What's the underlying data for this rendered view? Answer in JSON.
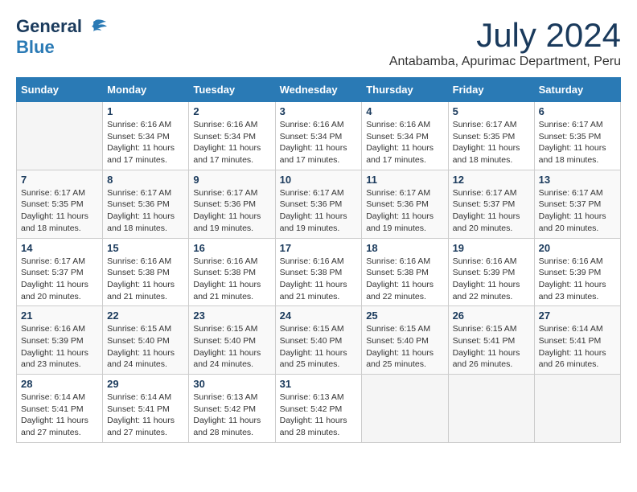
{
  "logo": {
    "general": "General",
    "blue": "Blue"
  },
  "title": "July 2024",
  "location": "Antabamba, Apurimac Department, Peru",
  "headers": [
    "Sunday",
    "Monday",
    "Tuesday",
    "Wednesday",
    "Thursday",
    "Friday",
    "Saturday"
  ],
  "weeks": [
    [
      {
        "day": "",
        "sunrise": "",
        "sunset": "",
        "daylight": ""
      },
      {
        "day": "1",
        "sunrise": "Sunrise: 6:16 AM",
        "sunset": "Sunset: 5:34 PM",
        "daylight": "Daylight: 11 hours and 17 minutes."
      },
      {
        "day": "2",
        "sunrise": "Sunrise: 6:16 AM",
        "sunset": "Sunset: 5:34 PM",
        "daylight": "Daylight: 11 hours and 17 minutes."
      },
      {
        "day": "3",
        "sunrise": "Sunrise: 6:16 AM",
        "sunset": "Sunset: 5:34 PM",
        "daylight": "Daylight: 11 hours and 17 minutes."
      },
      {
        "day": "4",
        "sunrise": "Sunrise: 6:16 AM",
        "sunset": "Sunset: 5:34 PM",
        "daylight": "Daylight: 11 hours and 17 minutes."
      },
      {
        "day": "5",
        "sunrise": "Sunrise: 6:17 AM",
        "sunset": "Sunset: 5:35 PM",
        "daylight": "Daylight: 11 hours and 18 minutes."
      },
      {
        "day": "6",
        "sunrise": "Sunrise: 6:17 AM",
        "sunset": "Sunset: 5:35 PM",
        "daylight": "Daylight: 11 hours and 18 minutes."
      }
    ],
    [
      {
        "day": "7",
        "sunrise": "Sunrise: 6:17 AM",
        "sunset": "Sunset: 5:35 PM",
        "daylight": "Daylight: 11 hours and 18 minutes."
      },
      {
        "day": "8",
        "sunrise": "Sunrise: 6:17 AM",
        "sunset": "Sunset: 5:36 PM",
        "daylight": "Daylight: 11 hours and 18 minutes."
      },
      {
        "day": "9",
        "sunrise": "Sunrise: 6:17 AM",
        "sunset": "Sunset: 5:36 PM",
        "daylight": "Daylight: 11 hours and 19 minutes."
      },
      {
        "day": "10",
        "sunrise": "Sunrise: 6:17 AM",
        "sunset": "Sunset: 5:36 PM",
        "daylight": "Daylight: 11 hours and 19 minutes."
      },
      {
        "day": "11",
        "sunrise": "Sunrise: 6:17 AM",
        "sunset": "Sunset: 5:36 PM",
        "daylight": "Daylight: 11 hours and 19 minutes."
      },
      {
        "day": "12",
        "sunrise": "Sunrise: 6:17 AM",
        "sunset": "Sunset: 5:37 PM",
        "daylight": "Daylight: 11 hours and 20 minutes."
      },
      {
        "day": "13",
        "sunrise": "Sunrise: 6:17 AM",
        "sunset": "Sunset: 5:37 PM",
        "daylight": "Daylight: 11 hours and 20 minutes."
      }
    ],
    [
      {
        "day": "14",
        "sunrise": "Sunrise: 6:17 AM",
        "sunset": "Sunset: 5:37 PM",
        "daylight": "Daylight: 11 hours and 20 minutes."
      },
      {
        "day": "15",
        "sunrise": "Sunrise: 6:16 AM",
        "sunset": "Sunset: 5:38 PM",
        "daylight": "Daylight: 11 hours and 21 minutes."
      },
      {
        "day": "16",
        "sunrise": "Sunrise: 6:16 AM",
        "sunset": "Sunset: 5:38 PM",
        "daylight": "Daylight: 11 hours and 21 minutes."
      },
      {
        "day": "17",
        "sunrise": "Sunrise: 6:16 AM",
        "sunset": "Sunset: 5:38 PM",
        "daylight": "Daylight: 11 hours and 21 minutes."
      },
      {
        "day": "18",
        "sunrise": "Sunrise: 6:16 AM",
        "sunset": "Sunset: 5:38 PM",
        "daylight": "Daylight: 11 hours and 22 minutes."
      },
      {
        "day": "19",
        "sunrise": "Sunrise: 6:16 AM",
        "sunset": "Sunset: 5:39 PM",
        "daylight": "Daylight: 11 hours and 22 minutes."
      },
      {
        "day": "20",
        "sunrise": "Sunrise: 6:16 AM",
        "sunset": "Sunset: 5:39 PM",
        "daylight": "Daylight: 11 hours and 23 minutes."
      }
    ],
    [
      {
        "day": "21",
        "sunrise": "Sunrise: 6:16 AM",
        "sunset": "Sunset: 5:39 PM",
        "daylight": "Daylight: 11 hours and 23 minutes."
      },
      {
        "day": "22",
        "sunrise": "Sunrise: 6:15 AM",
        "sunset": "Sunset: 5:40 PM",
        "daylight": "Daylight: 11 hours and 24 minutes."
      },
      {
        "day": "23",
        "sunrise": "Sunrise: 6:15 AM",
        "sunset": "Sunset: 5:40 PM",
        "daylight": "Daylight: 11 hours and 24 minutes."
      },
      {
        "day": "24",
        "sunrise": "Sunrise: 6:15 AM",
        "sunset": "Sunset: 5:40 PM",
        "daylight": "Daylight: 11 hours and 25 minutes."
      },
      {
        "day": "25",
        "sunrise": "Sunrise: 6:15 AM",
        "sunset": "Sunset: 5:40 PM",
        "daylight": "Daylight: 11 hours and 25 minutes."
      },
      {
        "day": "26",
        "sunrise": "Sunrise: 6:15 AM",
        "sunset": "Sunset: 5:41 PM",
        "daylight": "Daylight: 11 hours and 26 minutes."
      },
      {
        "day": "27",
        "sunrise": "Sunrise: 6:14 AM",
        "sunset": "Sunset: 5:41 PM",
        "daylight": "Daylight: 11 hours and 26 minutes."
      }
    ],
    [
      {
        "day": "28",
        "sunrise": "Sunrise: 6:14 AM",
        "sunset": "Sunset: 5:41 PM",
        "daylight": "Daylight: 11 hours and 27 minutes."
      },
      {
        "day": "29",
        "sunrise": "Sunrise: 6:14 AM",
        "sunset": "Sunset: 5:41 PM",
        "daylight": "Daylight: 11 hours and 27 minutes."
      },
      {
        "day": "30",
        "sunrise": "Sunrise: 6:13 AM",
        "sunset": "Sunset: 5:42 PM",
        "daylight": "Daylight: 11 hours and 28 minutes."
      },
      {
        "day": "31",
        "sunrise": "Sunrise: 6:13 AM",
        "sunset": "Sunset: 5:42 PM",
        "daylight": "Daylight: 11 hours and 28 minutes."
      },
      {
        "day": "",
        "sunrise": "",
        "sunset": "",
        "daylight": ""
      },
      {
        "day": "",
        "sunrise": "",
        "sunset": "",
        "daylight": ""
      },
      {
        "day": "",
        "sunrise": "",
        "sunset": "",
        "daylight": ""
      }
    ]
  ]
}
